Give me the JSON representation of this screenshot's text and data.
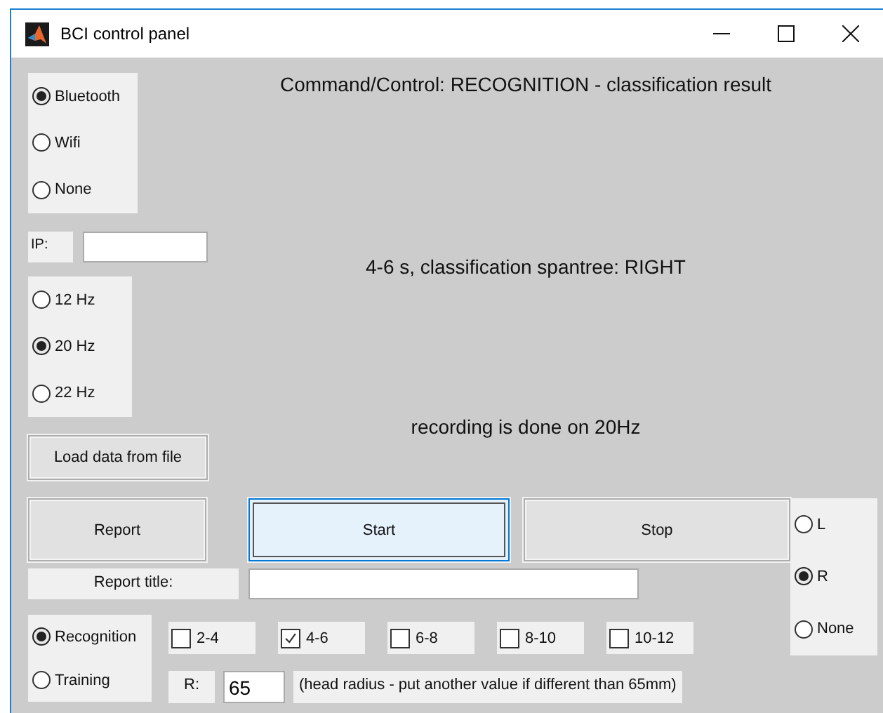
{
  "window": {
    "title": "BCI control panel"
  },
  "connection": [
    {
      "label": "Bluetooth",
      "selected": true
    },
    {
      "label": "Wifi",
      "selected": false
    },
    {
      "label": "None",
      "selected": false
    }
  ],
  "ip": {
    "label": "IP:"
  },
  "frequency": [
    {
      "label": "12 Hz",
      "selected": false
    },
    {
      "label": "20 Hz",
      "selected": true
    },
    {
      "label": "22 Hz",
      "selected": false
    }
  ],
  "load_button": "Load data from file",
  "messages": [
    "Command/Control: RECOGNITION - classification result",
    "4-6 s, classification spantree: RIGHT",
    "recording is done on 20Hz"
  ],
  "buttons": [
    {
      "label": "Report",
      "focused": false
    },
    {
      "label": "Start",
      "focused": true
    },
    {
      "label": "Stop",
      "focused": false
    }
  ],
  "report_title": {
    "label": "Report title:"
  },
  "side": [
    {
      "label": "L",
      "selected": false
    },
    {
      "label": "R",
      "selected": true
    },
    {
      "label": "None",
      "selected": false
    }
  ],
  "mode": [
    {
      "label": "Recognition",
      "selected": true
    },
    {
      "label": "Training",
      "selected": false
    }
  ],
  "windows": [
    {
      "label": "2-4",
      "checked": false
    },
    {
      "label": "4-6",
      "checked": true
    },
    {
      "label": "6-8",
      "checked": false
    },
    {
      "label": "8-10",
      "checked": false
    },
    {
      "label": "10-12",
      "checked": false
    }
  ],
  "radius": {
    "label": "R:",
    "value": "65",
    "hint": "(head radius - put another value if different than 65mm)"
  }
}
